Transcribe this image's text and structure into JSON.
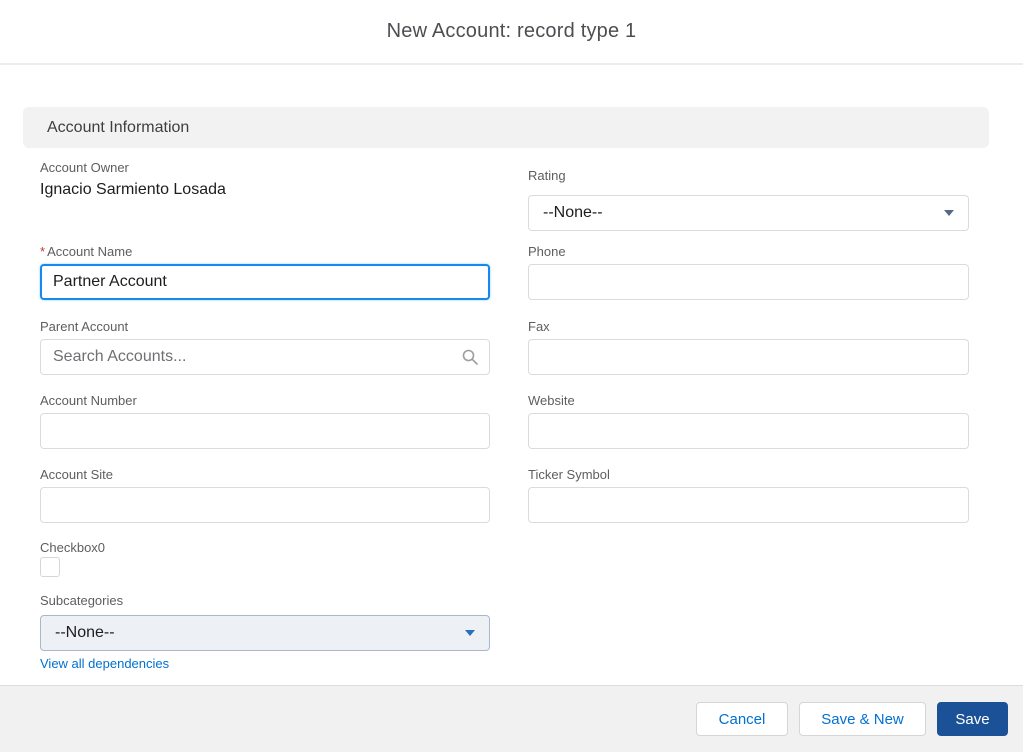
{
  "modal": {
    "title": "New Account: record type 1"
  },
  "section": {
    "title": "Account Information"
  },
  "required_marker": "*",
  "fields": {
    "account_owner": {
      "label": "Account Owner",
      "value": "Ignacio Sarmiento Losada"
    },
    "account_name": {
      "label": "Account Name",
      "value": "Partner Account",
      "required": true
    },
    "parent_account": {
      "label": "Parent Account",
      "placeholder": "Search Accounts..."
    },
    "account_number": {
      "label": "Account Number",
      "value": ""
    },
    "account_site": {
      "label": "Account Site",
      "value": ""
    },
    "checkbox0": {
      "label": "Checkbox0",
      "checked": false
    },
    "subcategories": {
      "label": "Subcategories",
      "value": "--None--",
      "link": "View all dependencies"
    },
    "rating": {
      "label": "Rating",
      "value": "--None--"
    },
    "phone": {
      "label": "Phone",
      "value": ""
    },
    "fax": {
      "label": "Fax",
      "value": ""
    },
    "website": {
      "label": "Website",
      "value": ""
    },
    "ticker_symbol": {
      "label": "Ticker Symbol",
      "value": ""
    }
  },
  "footer": {
    "cancel_label": "Cancel",
    "save_new_label": "Save & New",
    "save_label": "Save"
  },
  "colors": {
    "accent": "#0070d2",
    "save_button": "#1b5297",
    "focus_border": "#1589ee",
    "required": "#c23934",
    "section_bg": "#f2f2f2",
    "footer_bg": "#f1f1f1"
  }
}
